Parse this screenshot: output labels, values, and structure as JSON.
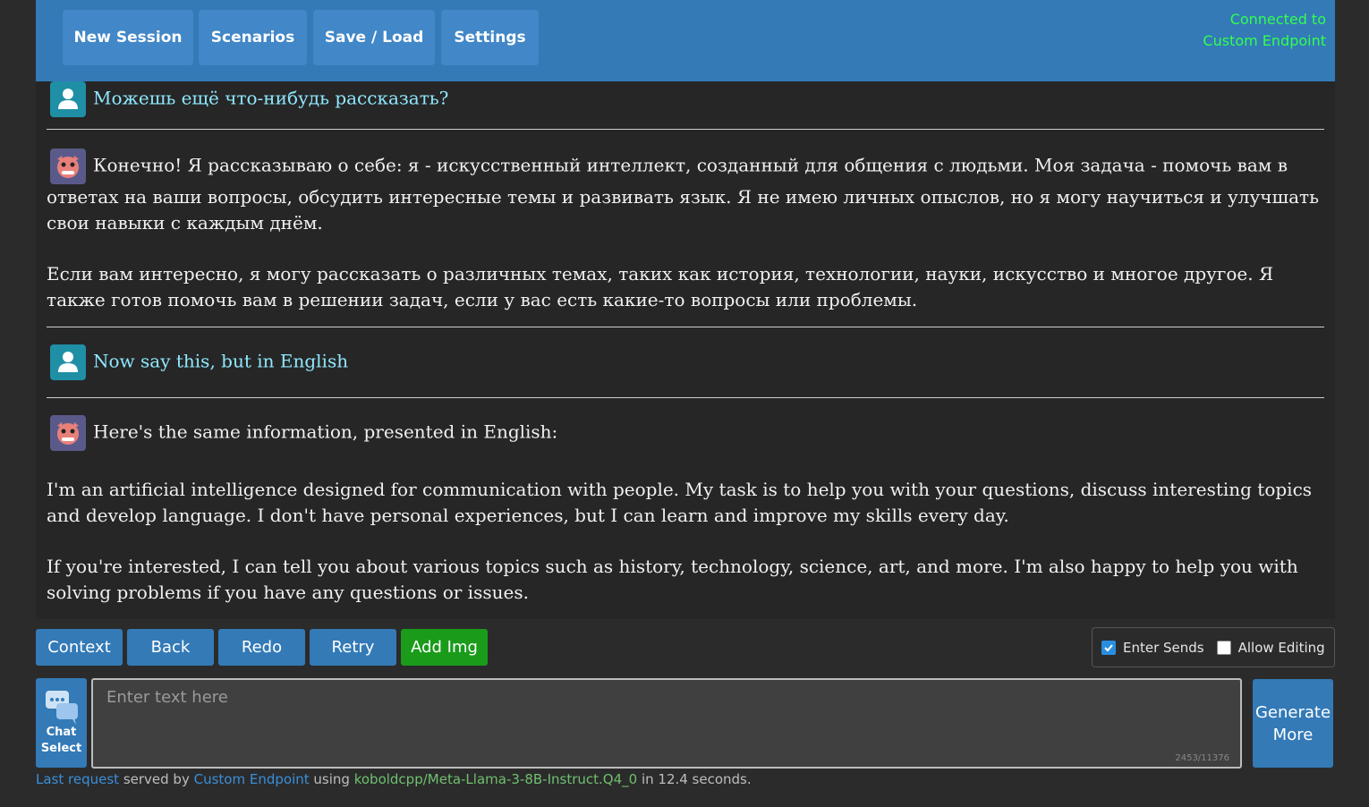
{
  "nav": {
    "new_session": "New Session",
    "scenarios": "Scenarios",
    "save_load": "Save / Load",
    "settings": "Settings",
    "connection_status": "Connected to Custom Endpoint"
  },
  "messages": [
    {
      "role": "user",
      "text": "Можешь ещё что-нибудь рассказать?"
    },
    {
      "role": "bot",
      "paragraphs": [
        "Конечно! Я рассказываю о себе: я - искусственный интеллект, созданный для общения с людьми. Моя задача - помочь вам в ответах на ваши вопросы, обсудить интересные темы и развивать язык. Я не имею личных опыслов, но я могу научиться и улучшать свои навыки с каждым днём.",
        "Если вам интересно, я могу рассказать о различных темах, таких как история, технологии, науки, искусство и многое другое. Я также готов помочь вам в решении задач, если у вас есть какие-то вопросы или проблемы."
      ]
    },
    {
      "role": "user",
      "text": "Now say this, but in English"
    },
    {
      "role": "bot",
      "paragraphs": [
        "Here's the same information, presented in English:",
        "I'm an artificial intelligence designed for communication with people. My task is to help you with your questions, discuss interesting topics and develop language. I don't have personal experiences, but I can learn and improve my skills every day.",
        "If you're interested, I can tell you about various topics such as history, technology, science, art, and more. I'm also happy to help you with solving problems if you have any questions or issues."
      ]
    }
  ],
  "controls": {
    "context": "Context",
    "back": "Back",
    "redo": "Redo",
    "retry": "Retry",
    "add_img": "Add Img",
    "enter_sends": {
      "label": "Enter Sends",
      "checked": true
    },
    "allow_editing": {
      "label": "Allow Editing",
      "checked": false
    }
  },
  "input": {
    "placeholder": "Enter text here",
    "counter": "2453/11376",
    "chat_select_line1": "Chat",
    "chat_select_line2": "Select",
    "generate_line1": "Generate",
    "generate_line2": "More"
  },
  "status_bar": {
    "last_request": "Last request",
    "served_by": "served by",
    "endpoint": "Custom Endpoint",
    "using": "using",
    "model": "koboldcpp/Meta-Llama-3-8B-Instruct.Q4_0",
    "timing": "in 12.4 seconds."
  },
  "colors": {
    "accent": "#337ab7",
    "connected": "#33ff4d",
    "add_img": "#1a9b1a",
    "user_text": "#8fe8ff"
  }
}
